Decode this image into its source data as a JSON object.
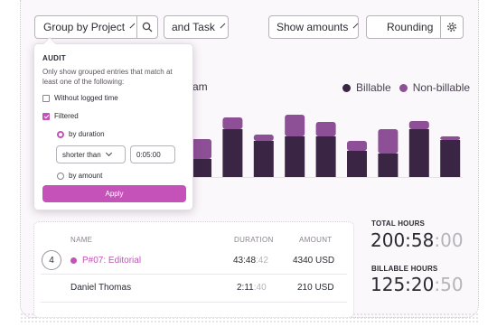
{
  "toolbar": {
    "group_label": "Group by Project",
    "task_label": "and Task",
    "amounts_label": "Show amounts",
    "rounding_label": "Rounding"
  },
  "popup": {
    "title": "AUDIT",
    "description": "Only show grouped entries that match at least one of the following:",
    "without_logged": "Without logged time",
    "filtered": "Filtered",
    "by_duration": "by duration",
    "comparison": "shorter than",
    "duration_value": "0:05:00",
    "by_amount": "by amount",
    "apply": "Apply"
  },
  "chart": {
    "title_fragment": "am",
    "legend": [
      {
        "name": "Billable",
        "color": "#3b2545"
      },
      {
        "name": "Non-billable",
        "color": "#8d4f96"
      }
    ]
  },
  "chart_data": {
    "type": "bar",
    "series": [
      {
        "name": "Billable",
        "values": [
          20,
          53,
          40,
          45,
          45,
          29,
          26,
          53,
          41
        ]
      },
      {
        "name": "Non-billable",
        "values": [
          22,
          13,
          7,
          24,
          16,
          11,
          27,
          9,
          4
        ]
      }
    ]
  },
  "colors": {
    "accent": "#c552b8",
    "billable": "#3b2545",
    "nonbillable": "#8d4f96"
  },
  "table": {
    "headers": {
      "name": "NAME",
      "duration": "DURATION",
      "amount": "AMOUNT"
    },
    "group_count": "4",
    "rows": [
      {
        "name": "P#07: Editorial",
        "duration_main": "43:48",
        "duration_sec": ":42",
        "amount": "4340 USD"
      },
      {
        "name": "Daniel Thomas",
        "duration_main": "2:11",
        "duration_sec": ":40",
        "amount": "210 USD"
      }
    ]
  },
  "totals": {
    "total_label": "TOTAL HOURS",
    "total_main": "200:58",
    "total_sec": ":00",
    "billable_label": "BILLABLE HOURS",
    "billable_main": "125:20",
    "billable_sec": ":50"
  }
}
